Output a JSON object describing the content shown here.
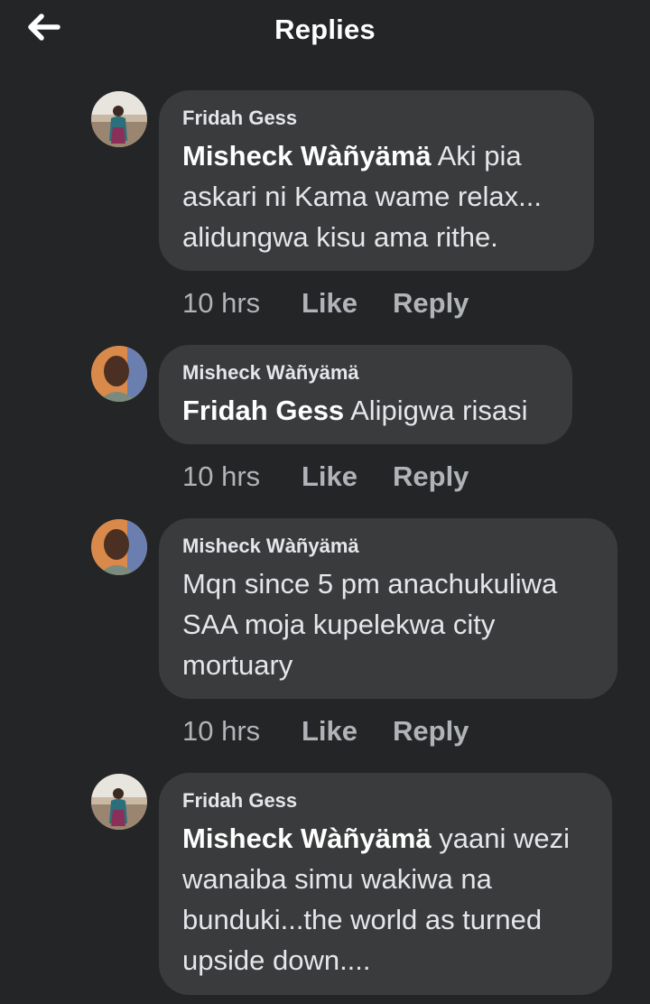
{
  "header": {
    "title": "Replies"
  },
  "comments": [
    {
      "author": "Fridah Gess",
      "mention": "Misheck Wàñyämä",
      "text": " Aki pia askari ni Kama wame relax... alidungwa kisu ama rithe.",
      "time": "10 hrs",
      "like": "Like",
      "reply": "Reply"
    },
    {
      "author": "Misheck Wàñyämä",
      "mention": "Fridah Gess",
      "text": " Alipigwa risasi",
      "time": "10 hrs",
      "like": "Like",
      "reply": "Reply"
    },
    {
      "author": "Misheck Wàñyämä",
      "mention": "",
      "text": "Mqn since 5 pm anachukuliwa SAA moja kupelekwa city mortuary",
      "time": "10 hrs",
      "like": "Like",
      "reply": "Reply"
    },
    {
      "author": "Fridah Gess",
      "mention": "Misheck Wàñyämä",
      "text": " yaani wezi wanaiba simu wakiwa na bunduki...the world as turned upside down....",
      "time": "",
      "like": "",
      "reply": ""
    }
  ]
}
